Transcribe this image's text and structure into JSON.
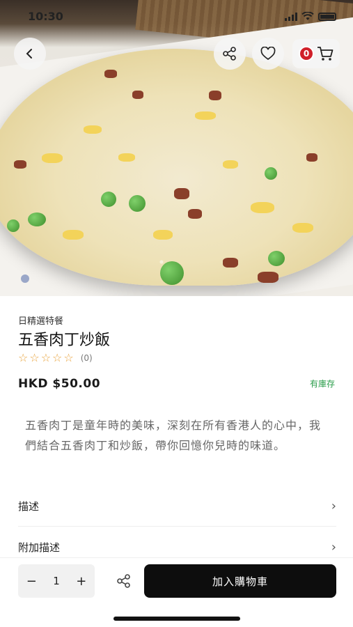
{
  "status_bar": {
    "time": "10:30"
  },
  "header": {
    "back_icon": "chevron-left-icon",
    "share_icon": "share-icon",
    "favorite_icon": "heart-icon",
    "cart_icon": "cart-icon",
    "cart_count": "0"
  },
  "gallery": {
    "current_page": 1
  },
  "product": {
    "category": "日精選特餐",
    "name": "五香肉丁炒飯",
    "rating_stars": 0,
    "rating_count": "(0)",
    "price": "HKD $50.00",
    "stock_status": "有庫存",
    "description": "五香肉丁是童年時的美味，深刻在所有香港人的心中，我們結合五香肉丁和炒飯，帶你回憶你兒時的味道。"
  },
  "sections": [
    {
      "label": "描述"
    },
    {
      "label": "附加描述"
    }
  ],
  "bottom_bar": {
    "minus": "−",
    "quantity": "1",
    "plus": "+",
    "add_to_cart_label": "加入購物車"
  },
  "colors": {
    "accent": "#0d0d0d",
    "badge": "#d0202a",
    "stock": "#2a9d4a",
    "star": "#e8a23a"
  }
}
